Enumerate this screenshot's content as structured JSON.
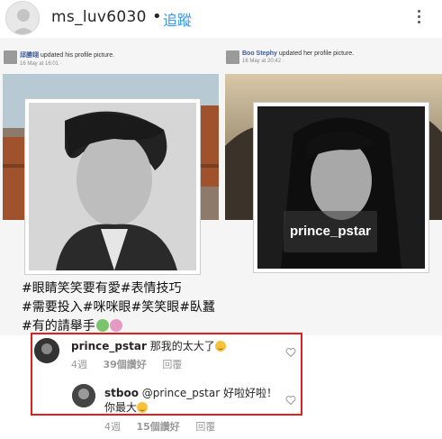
{
  "header": {
    "username": "ms_luv6030",
    "separator": "•",
    "follow_label": "追蹤"
  },
  "post": {
    "left_fb": {
      "name": "邱勝翊",
      "action": "updated his profile picture.",
      "date": "16 May at 16:01 ·"
    },
    "right_fb": {
      "name": "Boo Stephy",
      "action": "updated her profile picture.",
      "date": "16 May at 20:42 ·"
    },
    "watermark": "prince_pstar"
  },
  "caption": {
    "lines": [
      "#眼睛笑笑要有愛#表情技巧",
      "#需要投入#咪咪眼#笑笑眼#臥蠶",
      "#有的請舉手"
    ]
  },
  "comments": [
    {
      "user": "prince_pstar",
      "text": "那我的太大了",
      "time": "4週",
      "likes": "39個讚好",
      "reply": "回覆"
    },
    {
      "user": "stboo",
      "text": "@prince_pstar 好啦好啦！",
      "text2": "你最大",
      "time": "4週",
      "likes": "15個讚好",
      "reply": "回覆"
    }
  ],
  "colors": {
    "follow": "#3897f0",
    "highlight": "#e02020"
  }
}
